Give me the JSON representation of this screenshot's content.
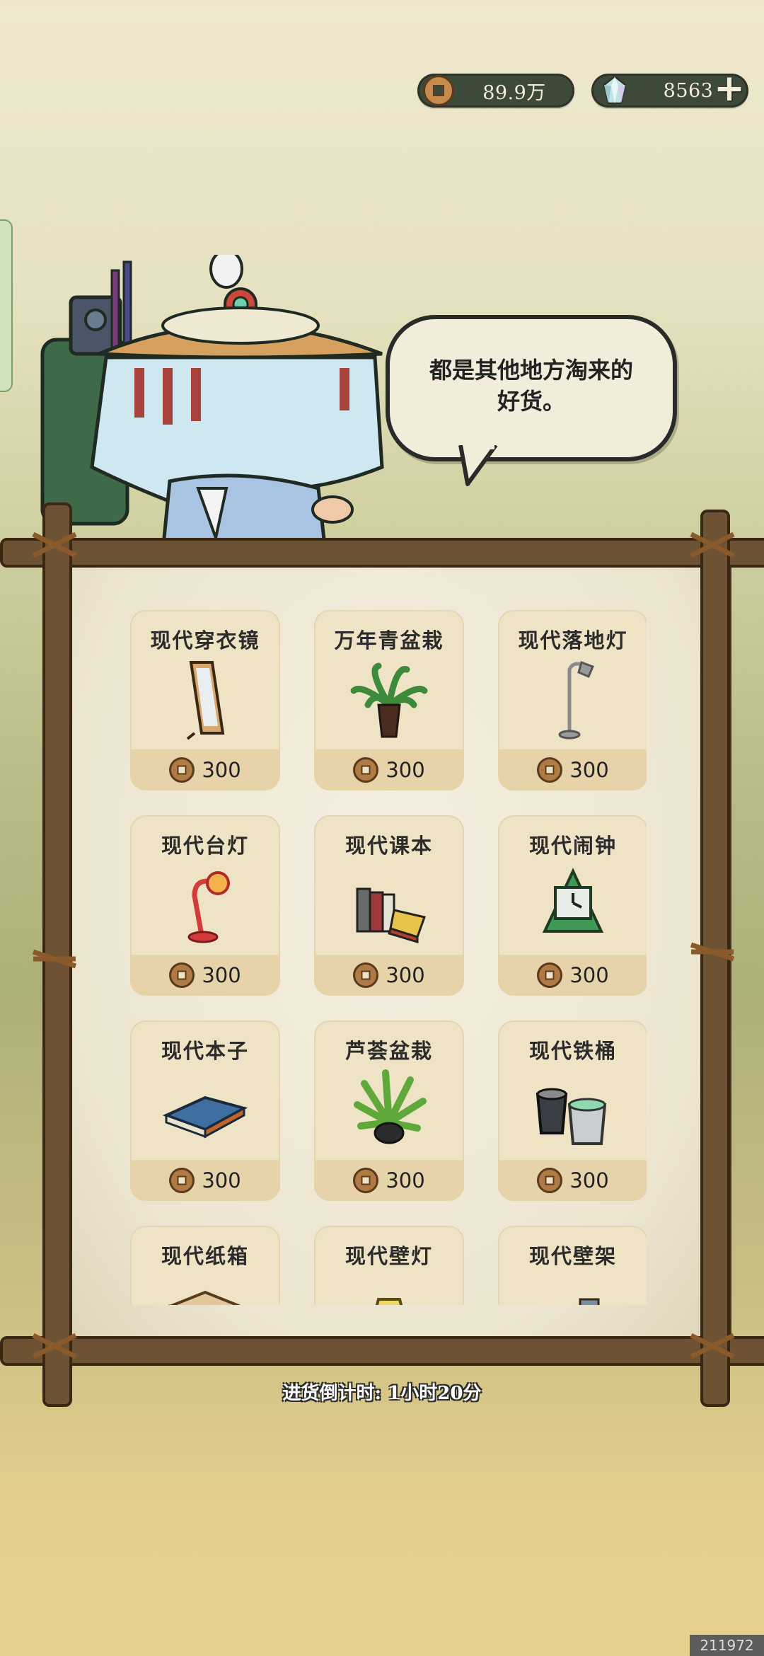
{
  "currency": {
    "coins": "89.9万",
    "gems": "8563"
  },
  "icons": {
    "coin": "copper-coin-icon",
    "gem": "crystal-gem-icon",
    "plus": "plus-icon"
  },
  "dialogue": {
    "line1": "都是其他地方淘来的",
    "line2": "好货。"
  },
  "items": [
    {
      "name": "现代穿衣镜",
      "price": "300",
      "icon": "mirror-icon"
    },
    {
      "name": "万年青盆栽",
      "price": "300",
      "icon": "potted-plant-icon"
    },
    {
      "name": "现代落地灯",
      "price": "300",
      "icon": "floor-lamp-icon"
    },
    {
      "name": "现代台灯",
      "price": "300",
      "icon": "desk-lamp-icon"
    },
    {
      "name": "现代课本",
      "price": "300",
      "icon": "books-icon"
    },
    {
      "name": "现代闹钟",
      "price": "300",
      "icon": "alarm-clock-icon"
    },
    {
      "name": "现代本子",
      "price": "300",
      "icon": "notebook-icon"
    },
    {
      "name": "芦荟盆栽",
      "price": "300",
      "icon": "aloe-plant-icon"
    },
    {
      "name": "现代铁桶",
      "price": "300",
      "icon": "bucket-icon"
    },
    {
      "name": "现代纸箱",
      "price": "",
      "icon": "cardboard-box-icon"
    },
    {
      "name": "现代壁灯",
      "price": "",
      "icon": "wall-lamp-icon"
    },
    {
      "name": "现代壁架",
      "price": "",
      "icon": "wall-shelf-icon"
    }
  ],
  "restock": {
    "label": "进货倒计时: 1小时20分"
  },
  "watermark": "211972"
}
